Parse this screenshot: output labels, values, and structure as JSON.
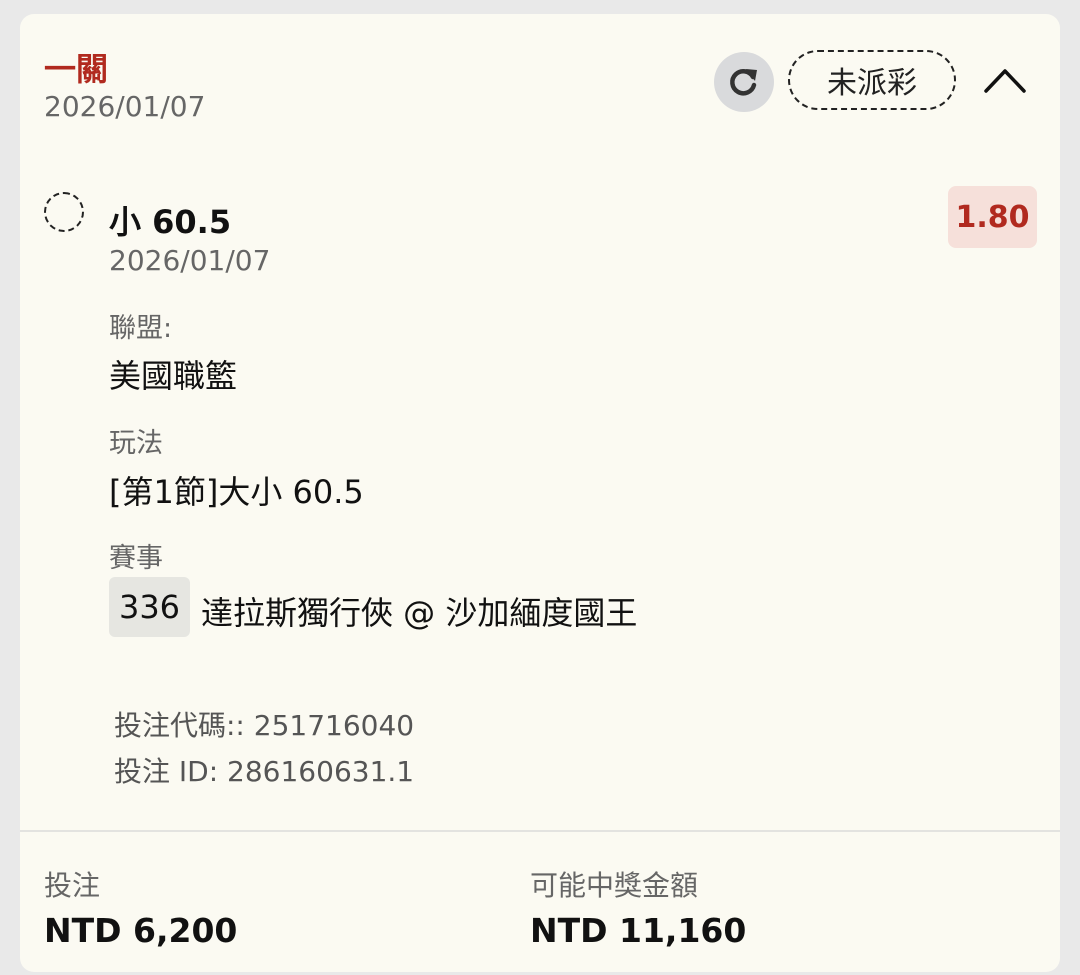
{
  "header": {
    "bet_type": "一關",
    "date": "2026/01/07",
    "status": "未派彩"
  },
  "selection": {
    "name": "小 60.5",
    "date": "2026/01/07",
    "odds": "1.80"
  },
  "details": {
    "league_label": "聯盟:",
    "league_value": "美國職籃",
    "market_label": "玩法",
    "market_value": "[第1節]大小 60.5",
    "event_label": "賽事",
    "event_id": "336",
    "event_name": "達拉斯獨行俠 @ 沙加緬度國王"
  },
  "codes": {
    "bet_code": "投注代碼:: 251716040",
    "bet_id": "投注 ID: 286160631.1"
  },
  "footer": {
    "stake_label": "投注",
    "stake_value": "NTD 6,200",
    "payout_label": "可能中獎金額",
    "payout_value": "NTD 11,160"
  },
  "icons": {
    "refresh": "refresh-icon",
    "collapse": "chevron-up-icon",
    "select": "dashed-circle-icon"
  },
  "colors": {
    "accent": "#b12a1f",
    "card_bg": "#fbfaf2",
    "odds_bg": "#f6e0da"
  }
}
